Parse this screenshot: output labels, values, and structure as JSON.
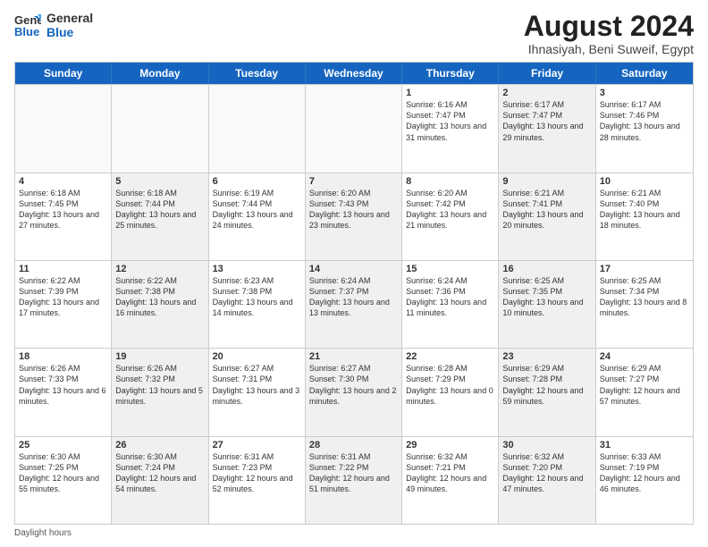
{
  "header": {
    "logo_line1": "General",
    "logo_line2": "Blue",
    "title": "August 2024",
    "subtitle": "Ihnasiyah, Beni Suweif, Egypt"
  },
  "days_of_week": [
    "Sunday",
    "Monday",
    "Tuesday",
    "Wednesday",
    "Thursday",
    "Friday",
    "Saturday"
  ],
  "footer_label": "Daylight hours",
  "weeks": [
    [
      {
        "day": "",
        "content": "",
        "shaded": false,
        "empty": true
      },
      {
        "day": "",
        "content": "",
        "shaded": false,
        "empty": true
      },
      {
        "day": "",
        "content": "",
        "shaded": false,
        "empty": true
      },
      {
        "day": "",
        "content": "",
        "shaded": false,
        "empty": true
      },
      {
        "day": "1",
        "content": "Sunrise: 6:16 AM\nSunset: 7:47 PM\nDaylight: 13 hours and 31 minutes.",
        "shaded": false,
        "empty": false
      },
      {
        "day": "2",
        "content": "Sunrise: 6:17 AM\nSunset: 7:47 PM\nDaylight: 13 hours and 29 minutes.",
        "shaded": true,
        "empty": false
      },
      {
        "day": "3",
        "content": "Sunrise: 6:17 AM\nSunset: 7:46 PM\nDaylight: 13 hours and 28 minutes.",
        "shaded": false,
        "empty": false
      }
    ],
    [
      {
        "day": "4",
        "content": "Sunrise: 6:18 AM\nSunset: 7:45 PM\nDaylight: 13 hours and 27 minutes.",
        "shaded": false,
        "empty": false
      },
      {
        "day": "5",
        "content": "Sunrise: 6:18 AM\nSunset: 7:44 PM\nDaylight: 13 hours and 25 minutes.",
        "shaded": true,
        "empty": false
      },
      {
        "day": "6",
        "content": "Sunrise: 6:19 AM\nSunset: 7:44 PM\nDaylight: 13 hours and 24 minutes.",
        "shaded": false,
        "empty": false
      },
      {
        "day": "7",
        "content": "Sunrise: 6:20 AM\nSunset: 7:43 PM\nDaylight: 13 hours and 23 minutes.",
        "shaded": true,
        "empty": false
      },
      {
        "day": "8",
        "content": "Sunrise: 6:20 AM\nSunset: 7:42 PM\nDaylight: 13 hours and 21 minutes.",
        "shaded": false,
        "empty": false
      },
      {
        "day": "9",
        "content": "Sunrise: 6:21 AM\nSunset: 7:41 PM\nDaylight: 13 hours and 20 minutes.",
        "shaded": true,
        "empty": false
      },
      {
        "day": "10",
        "content": "Sunrise: 6:21 AM\nSunset: 7:40 PM\nDaylight: 13 hours and 18 minutes.",
        "shaded": false,
        "empty": false
      }
    ],
    [
      {
        "day": "11",
        "content": "Sunrise: 6:22 AM\nSunset: 7:39 PM\nDaylight: 13 hours and 17 minutes.",
        "shaded": false,
        "empty": false
      },
      {
        "day": "12",
        "content": "Sunrise: 6:22 AM\nSunset: 7:38 PM\nDaylight: 13 hours and 16 minutes.",
        "shaded": true,
        "empty": false
      },
      {
        "day": "13",
        "content": "Sunrise: 6:23 AM\nSunset: 7:38 PM\nDaylight: 13 hours and 14 minutes.",
        "shaded": false,
        "empty": false
      },
      {
        "day": "14",
        "content": "Sunrise: 6:24 AM\nSunset: 7:37 PM\nDaylight: 13 hours and 13 minutes.",
        "shaded": true,
        "empty": false
      },
      {
        "day": "15",
        "content": "Sunrise: 6:24 AM\nSunset: 7:36 PM\nDaylight: 13 hours and 11 minutes.",
        "shaded": false,
        "empty": false
      },
      {
        "day": "16",
        "content": "Sunrise: 6:25 AM\nSunset: 7:35 PM\nDaylight: 13 hours and 10 minutes.",
        "shaded": true,
        "empty": false
      },
      {
        "day": "17",
        "content": "Sunrise: 6:25 AM\nSunset: 7:34 PM\nDaylight: 13 hours and 8 minutes.",
        "shaded": false,
        "empty": false
      }
    ],
    [
      {
        "day": "18",
        "content": "Sunrise: 6:26 AM\nSunset: 7:33 PM\nDaylight: 13 hours and 6 minutes.",
        "shaded": false,
        "empty": false
      },
      {
        "day": "19",
        "content": "Sunrise: 6:26 AM\nSunset: 7:32 PM\nDaylight: 13 hours and 5 minutes.",
        "shaded": true,
        "empty": false
      },
      {
        "day": "20",
        "content": "Sunrise: 6:27 AM\nSunset: 7:31 PM\nDaylight: 13 hours and 3 minutes.",
        "shaded": false,
        "empty": false
      },
      {
        "day": "21",
        "content": "Sunrise: 6:27 AM\nSunset: 7:30 PM\nDaylight: 13 hours and 2 minutes.",
        "shaded": true,
        "empty": false
      },
      {
        "day": "22",
        "content": "Sunrise: 6:28 AM\nSunset: 7:29 PM\nDaylight: 13 hours and 0 minutes.",
        "shaded": false,
        "empty": false
      },
      {
        "day": "23",
        "content": "Sunrise: 6:29 AM\nSunset: 7:28 PM\nDaylight: 12 hours and 59 minutes.",
        "shaded": true,
        "empty": false
      },
      {
        "day": "24",
        "content": "Sunrise: 6:29 AM\nSunset: 7:27 PM\nDaylight: 12 hours and 57 minutes.",
        "shaded": false,
        "empty": false
      }
    ],
    [
      {
        "day": "25",
        "content": "Sunrise: 6:30 AM\nSunset: 7:25 PM\nDaylight: 12 hours and 55 minutes.",
        "shaded": false,
        "empty": false
      },
      {
        "day": "26",
        "content": "Sunrise: 6:30 AM\nSunset: 7:24 PM\nDaylight: 12 hours and 54 minutes.",
        "shaded": true,
        "empty": false
      },
      {
        "day": "27",
        "content": "Sunrise: 6:31 AM\nSunset: 7:23 PM\nDaylight: 12 hours and 52 minutes.",
        "shaded": false,
        "empty": false
      },
      {
        "day": "28",
        "content": "Sunrise: 6:31 AM\nSunset: 7:22 PM\nDaylight: 12 hours and 51 minutes.",
        "shaded": true,
        "empty": false
      },
      {
        "day": "29",
        "content": "Sunrise: 6:32 AM\nSunset: 7:21 PM\nDaylight: 12 hours and 49 minutes.",
        "shaded": false,
        "empty": false
      },
      {
        "day": "30",
        "content": "Sunrise: 6:32 AM\nSunset: 7:20 PM\nDaylight: 12 hours and 47 minutes.",
        "shaded": true,
        "empty": false
      },
      {
        "day": "31",
        "content": "Sunrise: 6:33 AM\nSunset: 7:19 PM\nDaylight: 12 hours and 46 minutes.",
        "shaded": false,
        "empty": false
      }
    ]
  ]
}
